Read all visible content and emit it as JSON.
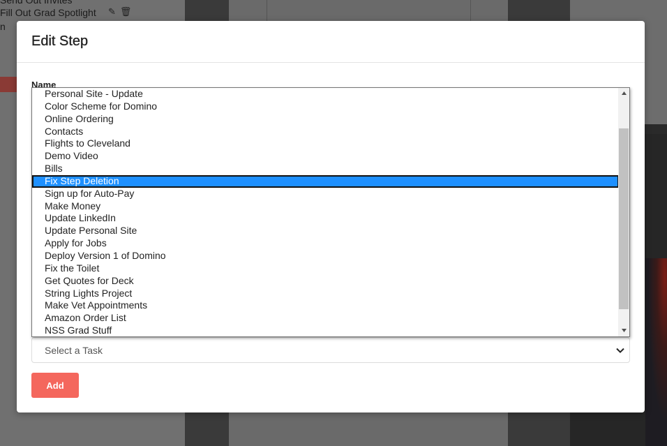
{
  "background": {
    "line1": "Send Out Invites",
    "line2": "Fill Out Grad Spotlight",
    "line3": "n"
  },
  "modal": {
    "title": "Edit Step",
    "name_label": "Name"
  },
  "dropdown": {
    "options": [
      "Personal Site - Update",
      "Color Scheme for Domino",
      "Online Ordering",
      "Contacts",
      "Flights to Cleveland",
      "Demo Video",
      "Bills",
      "Fix Step Deletion",
      "Sign up for Auto-Pay",
      "Make Money",
      "Update LinkedIn",
      "Update Personal Site",
      "Apply for Jobs",
      "Deploy Version 1 of Domino",
      "Fix the Toilet",
      "Get Quotes for Deck",
      "String Lights Project",
      "Make Vet Appointments",
      "Amazon Order List",
      "NSS Grad Stuff"
    ],
    "selected_option": "Fix Step Deletion",
    "scroll_fraction_start": 0.13,
    "scroll_fraction_end": 0.93
  },
  "task_select": {
    "value": "Select a Task"
  },
  "add_button": {
    "label": "Add"
  },
  "colors": {
    "accent": "#f4675d",
    "selection": "#1e90ff"
  },
  "icons": {
    "edit": "edit-icon",
    "trash": "trash-icon",
    "chevron": "chevron-down-icon"
  }
}
